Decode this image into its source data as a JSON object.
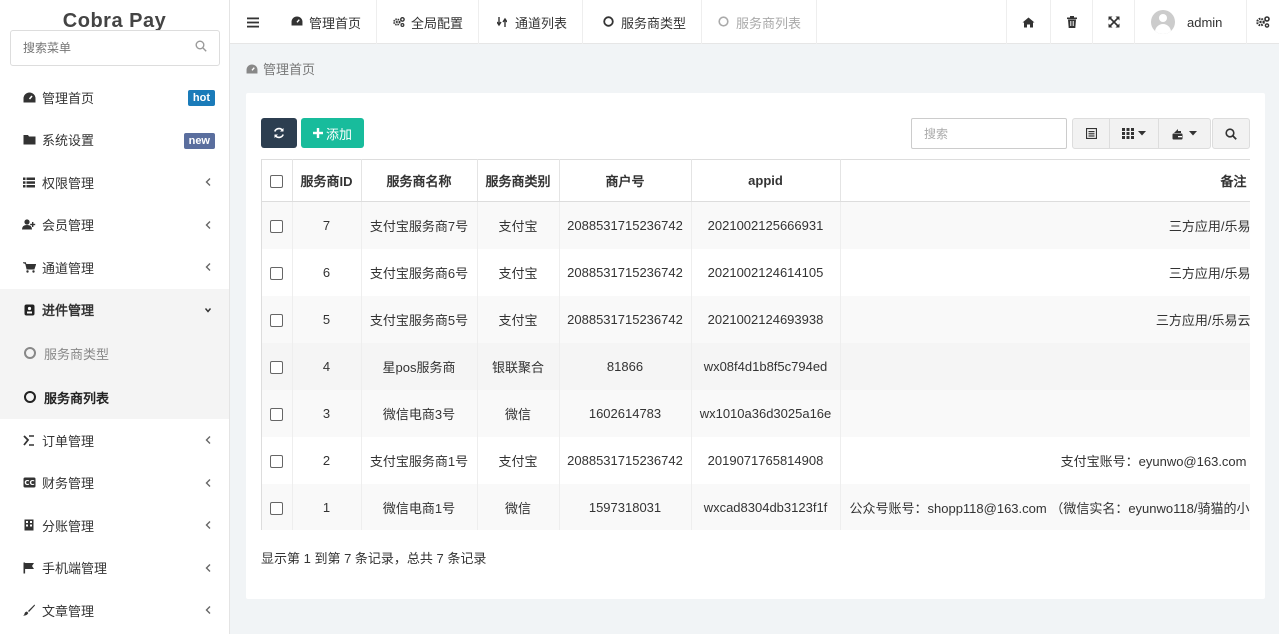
{
  "app": {
    "title": "Cobra Pay"
  },
  "sidebar": {
    "search_placeholder": "搜索菜单",
    "items": [
      {
        "label": "管理首页",
        "icon": "dashboard-icon",
        "badge": "hot"
      },
      {
        "label": "系统设置",
        "icon": "folder-icon",
        "badge": "new"
      },
      {
        "label": "权限管理",
        "icon": "list-icon"
      },
      {
        "label": "会员管理",
        "icon": "users-icon"
      },
      {
        "label": "通道管理",
        "icon": "cart-icon"
      },
      {
        "label": "进件管理",
        "icon": "file-icon",
        "open": true
      },
      {
        "label": "订单管理",
        "icon": "order-icon"
      },
      {
        "label": "财务管理",
        "icon": "finance-icon"
      },
      {
        "label": "分账管理",
        "icon": "building-icon"
      },
      {
        "label": "手机端管理",
        "icon": "flag-icon"
      },
      {
        "label": "文章管理",
        "icon": "brush-icon"
      }
    ],
    "subitems": [
      {
        "label": "服务商类型"
      },
      {
        "label": "服务商列表",
        "active": true
      }
    ]
  },
  "topbar": {
    "tabs": [
      {
        "label": "管理首页",
        "icon": "dashboard-icon"
      },
      {
        "label": "全局配置",
        "icon": "cogs-icon"
      },
      {
        "label": "通道列表",
        "icon": "exchange-icon"
      },
      {
        "label": "服务商类型",
        "icon": "circle-icon"
      },
      {
        "label": "服务商列表",
        "icon": "circle-icon"
      }
    ],
    "user": "admin"
  },
  "breadcrumb": {
    "label": "管理首页"
  },
  "toolbar": {
    "add_label": "添加",
    "search_placeholder": "搜索"
  },
  "table": {
    "columns": [
      "服务商ID",
      "服务商名称",
      "服务商类别",
      "商户号",
      "appid",
      "备注"
    ],
    "rows": [
      {
        "id": "7",
        "name": "支付宝服务商7号",
        "type": "支付宝",
        "merchant": "2088531715236742",
        "appid": "2021002125666931",
        "remark": "三方应用/乐易"
      },
      {
        "id": "6",
        "name": "支付宝服务商6号",
        "type": "支付宝",
        "merchant": "2088531715236742",
        "appid": "2021002124614105",
        "remark": "三方应用/乐易"
      },
      {
        "id": "5",
        "name": "支付宝服务商5号",
        "type": "支付宝",
        "merchant": "2088531715236742",
        "appid": "2021002124693938",
        "remark": "三方应用/乐易云"
      },
      {
        "id": "4",
        "name": "星pos服务商",
        "type": "银联聚合",
        "merchant": "81866",
        "appid": "wx08f4d1b8f5c794ed",
        "remark": ""
      },
      {
        "id": "3",
        "name": "微信电商3号",
        "type": "微信",
        "merchant": "1602614783",
        "appid": "wx1010a36d3025a16e",
        "remark": ""
      },
      {
        "id": "2",
        "name": "支付宝服务商1号",
        "type": "支付宝",
        "merchant": "2088531715236742",
        "appid": "2019071765814908",
        "remark": "支付宝账号：eyunwo@163.com"
      },
      {
        "id": "1",
        "name": "微信电商1号",
        "type": "微信",
        "merchant": "1597318031",
        "appid": "wxcad8304db3123f1f",
        "remark": "公众号账号：shopp118@163.com （微信实名：eyunwo118/骑猫的小"
      }
    ]
  },
  "pagination": {
    "info": "显示第 1 到第 7 条记录，总共 7 条记录"
  }
}
